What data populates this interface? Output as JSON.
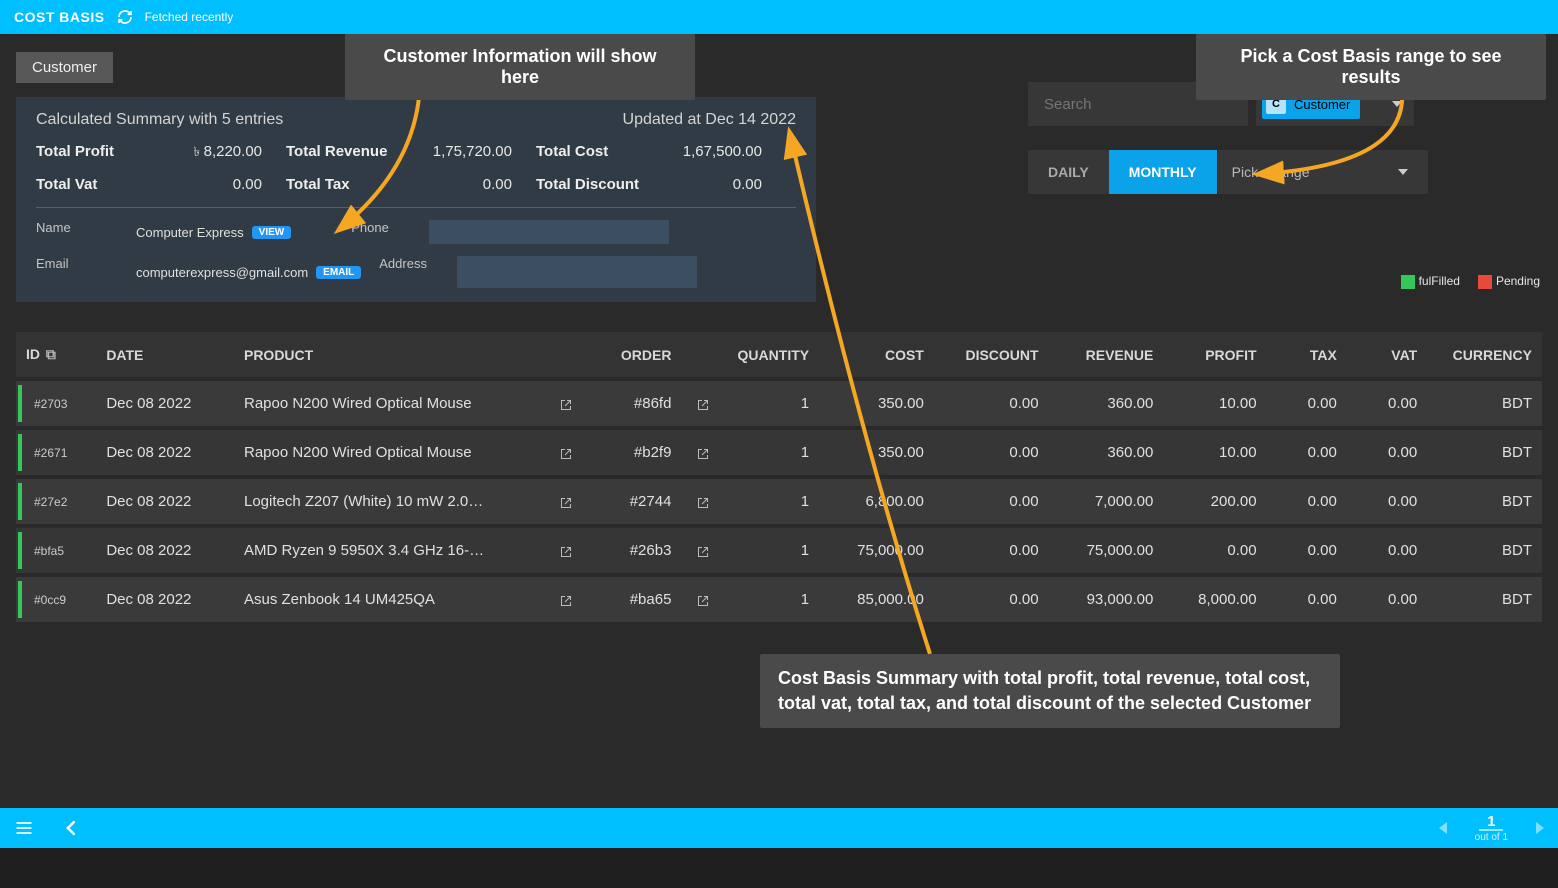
{
  "header": {
    "title": "COST BASIS",
    "fetched": "Fetched recently"
  },
  "tag": "Customer",
  "callouts": {
    "customerInfo": "Customer Information will show here",
    "rangeHint": "Pick a Cost Basis range to see results",
    "summaryHint": "Cost Basis Summary with total profit, total revenue, total cost, total vat, total tax, and total discount of the selected Customer"
  },
  "summary": {
    "title": "Calculated Summary with 5 entries",
    "updated": "Updated at Dec 14 2022",
    "labels": {
      "profit": "Total Profit",
      "revenue": "Total Revenue",
      "cost": "Total Cost",
      "vat": "Total Vat",
      "tax": "Total Tax",
      "discount": "Total Discount"
    },
    "values": {
      "profit": "8,220.00",
      "revenue": "1,75,720.00",
      "cost": "1,67,500.00",
      "vat": "0.00",
      "tax": "0.00",
      "discount": "0.00"
    },
    "details": {
      "nameLabel": "Name",
      "nameValue": "Computer Express",
      "viewBadge": "VIEW",
      "emailLabel": "Email",
      "emailValue": "computerexpress@gmail.com",
      "emailBadge": "EMAIL",
      "phoneLabel": "Phone",
      "addressLabel": "Address"
    }
  },
  "filters": {
    "searchPlaceholder": "Search",
    "customerChipLetter": "C",
    "customerChipLabel": "Customer",
    "daily": "DAILY",
    "monthly": "MONTHLY",
    "pickRange": "Pick a range"
  },
  "legend": {
    "fulfilled": "fulFilled",
    "pending": "Pending"
  },
  "table": {
    "headers": {
      "id": "ID",
      "date": "DATE",
      "product": "PRODUCT",
      "order": "ORDER",
      "quantity": "QUANTITY",
      "cost": "COST",
      "discount": "DISCOUNT",
      "revenue": "REVENUE",
      "profit": "PROFIT",
      "tax": "TAX",
      "vat": "VAT",
      "currency": "CURRENCY"
    },
    "rows": [
      {
        "id": "#2703",
        "date": "Dec 08 2022",
        "product": "Rapoo N200 Wired Optical Mouse",
        "order": "#86fd",
        "qty": "1",
        "cost": "350.00",
        "discount": "0.00",
        "revenue": "360.00",
        "profit": "10.00",
        "tax": "0.00",
        "vat": "0.00",
        "currency": "BDT"
      },
      {
        "id": "#2671",
        "date": "Dec 08 2022",
        "product": "Rapoo N200 Wired Optical Mouse",
        "order": "#b2f9",
        "qty": "1",
        "cost": "350.00",
        "discount": "0.00",
        "revenue": "360.00",
        "profit": "10.00",
        "tax": "0.00",
        "vat": "0.00",
        "currency": "BDT"
      },
      {
        "id": "#27e2",
        "date": "Dec 08 2022",
        "product": "Logitech Z207 (White) 10 mW 2.0…",
        "order": "#2744",
        "qty": "1",
        "cost": "6,800.00",
        "discount": "0.00",
        "revenue": "7,000.00",
        "profit": "200.00",
        "tax": "0.00",
        "vat": "0.00",
        "currency": "BDT"
      },
      {
        "id": "#bfa5",
        "date": "Dec 08 2022",
        "product": "AMD Ryzen 9 5950X 3.4 GHz 16-…",
        "order": "#26b3",
        "qty": "1",
        "cost": "75,000.00",
        "discount": "0.00",
        "revenue": "75,000.00",
        "profit": "0.00",
        "tax": "0.00",
        "vat": "0.00",
        "currency": "BDT"
      },
      {
        "id": "#0cc9",
        "date": "Dec 08 2022",
        "product": "Asus Zenbook 14 UM425QA",
        "order": "#ba65",
        "qty": "1",
        "cost": "85,000.00",
        "discount": "0.00",
        "revenue": "93,000.00",
        "profit": "8,000.00",
        "tax": "0.00",
        "vat": "0.00",
        "currency": "BDT"
      }
    ]
  },
  "footer": {
    "page": "1",
    "outof": "out of 1"
  }
}
